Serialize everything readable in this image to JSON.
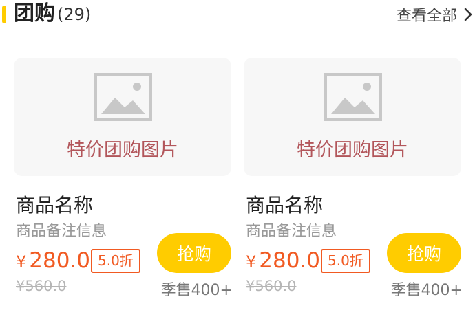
{
  "header": {
    "title": "团购",
    "count": "(29)",
    "view_all": "查看全部",
    "accent_color": "#FFCC00"
  },
  "products": [
    {
      "image_caption": "特价团购图片",
      "image_icon": "image-placeholder-icon",
      "name": "商品名称",
      "note": "商品备注信息",
      "currency": "¥",
      "price": "280.0",
      "discount": "5.0折",
      "original_price": "¥560.0",
      "buy_label": "抢购",
      "sales": "季售400+"
    },
    {
      "image_caption": "特价团购图片",
      "image_icon": "image-placeholder-icon",
      "name": "商品名称",
      "note": "商品备注信息",
      "currency": "¥",
      "price": "280.0",
      "discount": "5.0折",
      "original_price": "¥560.0",
      "buy_label": "抢购",
      "sales": "季售400+"
    }
  ],
  "colors": {
    "price": "#F15A22",
    "button": "#FFCC00",
    "caption": "#B2555A"
  }
}
